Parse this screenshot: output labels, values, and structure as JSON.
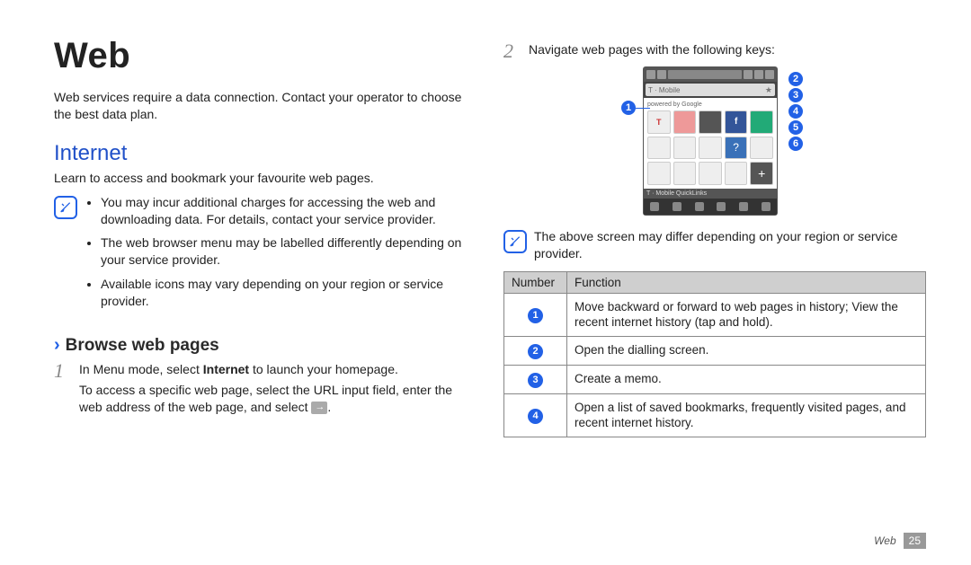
{
  "left": {
    "title": "Web",
    "intro": "Web services require a data connection. Contact your operator to choose the best data plan.",
    "section_head": "Internet",
    "section_sub": "Learn to access and bookmark your favourite web pages.",
    "notes": [
      "You may incur additional charges for accessing the web and downloading data. For details, contact your service provider.",
      "The web browser menu may be labelled differently depending on your service provider.",
      "Available icons may vary depending on your region or service provider."
    ],
    "subsection_title": "Browse web pages",
    "step1_num": "1",
    "step1_line1_a": "In Menu mode, select ",
    "step1_line1_bold": "Internet",
    "step1_line1_b": " to launch your homepage.",
    "step1_line2": "To access a specific web page, select the URL input field, enter the web address of the web page, and select ",
    "step1_line2_end": "."
  },
  "right": {
    "step2_num": "2",
    "step2_text": "Navigate web pages with the following keys:",
    "mock": {
      "addr_text": "T · Mobile",
      "brand": "powered by Google"
    },
    "note": "The above screen may differ depending on your region or service provider.",
    "table": {
      "head_num": "Number",
      "head_fn": "Function",
      "rows": [
        {
          "n": "1",
          "fn": "Move backward or forward to web pages in history; View the recent internet history (tap and hold)."
        },
        {
          "n": "2",
          "fn": "Open the dialling screen."
        },
        {
          "n": "3",
          "fn": "Create a memo."
        },
        {
          "n": "4",
          "fn": "Open a list of saved bookmarks, frequently visited pages, and recent internet history."
        }
      ]
    }
  },
  "footer": {
    "section": "Web",
    "page": "25"
  }
}
